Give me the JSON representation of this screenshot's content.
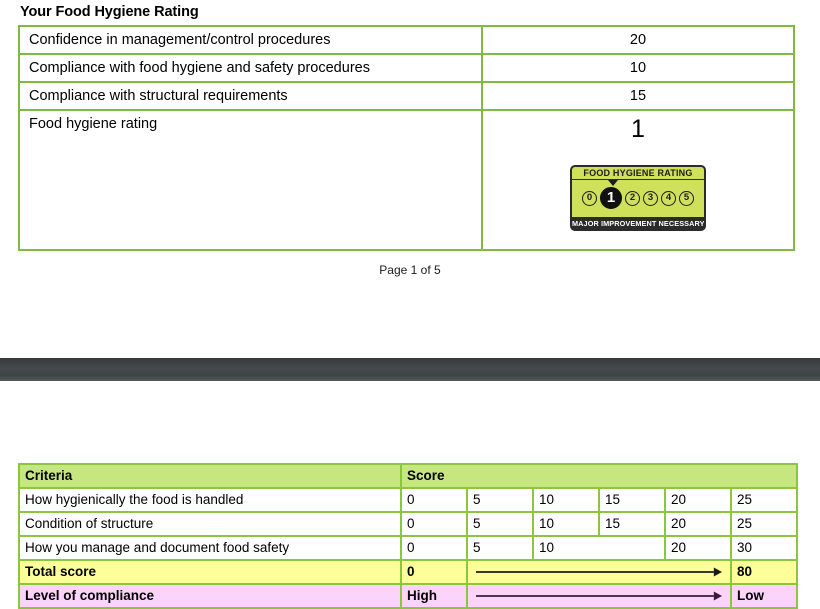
{
  "page_one": {
    "heading": "Your Food Hygiene Rating",
    "rating_rows": [
      {
        "label": "Confidence in management/control procedures",
        "value": "20"
      },
      {
        "label": "Compliance with food hygiene and safety procedures",
        "value": "10"
      },
      {
        "label": "Compliance with structural requirements",
        "value": "15"
      },
      {
        "label": "Food hygiene rating",
        "value": "1"
      }
    ],
    "badge": {
      "title": "FOOD HYGIENE RATING",
      "scale": [
        "0",
        "1",
        "2",
        "3",
        "4",
        "5"
      ],
      "active_value": "1",
      "footer": "MAJOR IMPROVEMENT NECESSARY",
      "colors": {
        "scale_background": "#cfe05a",
        "frame": "#2b2b2b",
        "active_circle": "#111111",
        "footer_text": "#ffffff"
      }
    },
    "footer_text": "Page 1 of 5"
  },
  "page_two": {
    "criteria_table": {
      "headers": {
        "criteria": "Criteria",
        "score": "Score"
      },
      "rows": [
        {
          "criteria": "How hygienically the food is handled",
          "scores": [
            "0",
            "5",
            "10",
            "15",
            "20",
            "25"
          ]
        },
        {
          "criteria": "Condition of structure",
          "scores": [
            "0",
            "5",
            "10",
            "15",
            "20",
            "25"
          ]
        },
        {
          "criteria": "How you manage and document food safety",
          "scores": [
            "0",
            "5",
            "10",
            "",
            "20",
            "30"
          ],
          "merged_note": "third score cell spans two columns"
        }
      ],
      "total_row": {
        "label": "Total score",
        "start": "0",
        "end": "80",
        "arrow": "right-arrow"
      },
      "compliance_row": {
        "label": "Level of compliance",
        "start": "High",
        "end": "Low",
        "arrow": "right-arrow"
      }
    }
  },
  "colors": {
    "table_border_green": "#8cc63e",
    "header_green": "#c6e67f",
    "total_yellow": "#ffff99",
    "compliance_pink": "#fbd3fb",
    "separator_gray": "#464b4e",
    "arrow_dark": "#1a1a1a",
    "arrow_purple": "#3a1a3a"
  }
}
